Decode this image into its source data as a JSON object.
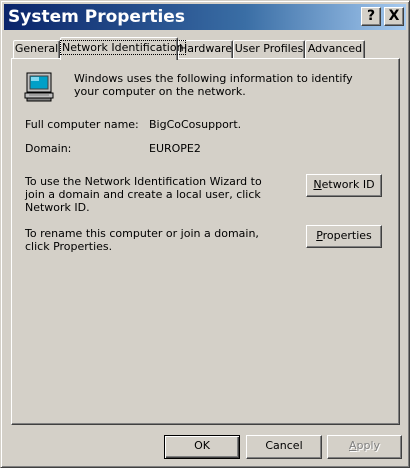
{
  "window": {
    "title": "System Properties",
    "help_glyph": "?",
    "close_glyph": "X"
  },
  "tabs": [
    {
      "label": "General",
      "selected": false
    },
    {
      "label": "Network Identification",
      "selected": true
    },
    {
      "label": "Hardware",
      "selected": false
    },
    {
      "label": "User Profiles",
      "selected": false
    },
    {
      "label": "Advanced",
      "selected": false
    }
  ],
  "network_id": {
    "icon": "computer-icon",
    "intro": "Windows uses the following information to identify your computer on the network.",
    "full_name_label": "Full computer name:",
    "full_name_value": "BigCoCosupport.",
    "domain_label": "Domain:",
    "domain_value": "EUROPE2",
    "wizard_text": "To use the Network Identification Wizard to join a domain and create a local user, click Network ID.",
    "network_id_button": {
      "mnemonic": "N",
      "rest": "etwork ID"
    },
    "rename_text": "To rename this computer or join a domain, click Properties.",
    "properties_button": {
      "mnemonic": "P",
      "rest": "roperties"
    }
  },
  "footer": {
    "ok": "OK",
    "cancel": "Cancel",
    "apply": {
      "mnemonic": "A",
      "rest": "pply"
    }
  },
  "colors": {
    "face": "#d4d0c8",
    "title_start": "#0a246a",
    "title_end": "#a6caf0"
  }
}
